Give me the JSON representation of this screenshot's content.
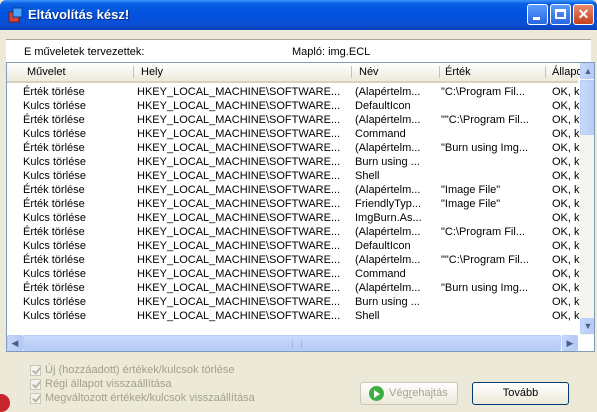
{
  "window": {
    "title": "Eltávolítás kész!"
  },
  "info": {
    "left": "E műveletek tervezettek:",
    "right": "Mapló: img.ECL"
  },
  "columns": [
    "Művelet",
    "Hely",
    "Név",
    "Érték",
    "Állapot"
  ],
  "rows": [
    [
      "Érték törlése",
      "HKEY_LOCAL_MACHINE\\SOFTWARE...",
      "(Alapértelm...",
      "\"C:\\Program Fil...",
      "OK, k..."
    ],
    [
      "Kulcs törlése",
      "HKEY_LOCAL_MACHINE\\SOFTWARE...",
      "DefaultIcon",
      "",
      "OK, k..."
    ],
    [
      "Érték törlése",
      "HKEY_LOCAL_MACHINE\\SOFTWARE...",
      "(Alapértelm...",
      "\"\"C:\\Program Fil...",
      "OK, k..."
    ],
    [
      "Kulcs törlése",
      "HKEY_LOCAL_MACHINE\\SOFTWARE...",
      "Command",
      "",
      "OK, k..."
    ],
    [
      "Érték törlése",
      "HKEY_LOCAL_MACHINE\\SOFTWARE...",
      "(Alapértelm...",
      "\"Burn using Img...",
      "OK, k..."
    ],
    [
      "Kulcs törlése",
      "HKEY_LOCAL_MACHINE\\SOFTWARE...",
      "Burn using ...",
      "",
      "OK, k..."
    ],
    [
      "Kulcs törlése",
      "HKEY_LOCAL_MACHINE\\SOFTWARE...",
      "Shell",
      "",
      "OK, k..."
    ],
    [
      "Érték törlése",
      "HKEY_LOCAL_MACHINE\\SOFTWARE...",
      "(Alapértelm...",
      "\"Image File\"",
      "OK, k..."
    ],
    [
      "Érték törlése",
      "HKEY_LOCAL_MACHINE\\SOFTWARE...",
      "FriendlyTyp...",
      "\"Image File\"",
      "OK, k..."
    ],
    [
      "Kulcs törlése",
      "HKEY_LOCAL_MACHINE\\SOFTWARE...",
      "ImgBurn.As...",
      "",
      "OK, k..."
    ],
    [
      "Érték törlése",
      "HKEY_LOCAL_MACHINE\\SOFTWARE...",
      "(Alapértelm...",
      "\"C:\\Program Fil...",
      "OK, k..."
    ],
    [
      "Kulcs törlése",
      "HKEY_LOCAL_MACHINE\\SOFTWARE...",
      "DefaultIcon",
      "",
      "OK, k..."
    ],
    [
      "Érték törlése",
      "HKEY_LOCAL_MACHINE\\SOFTWARE...",
      "(Alapértelm...",
      "\"\"C:\\Program Fil...",
      "OK, k..."
    ],
    [
      "Kulcs törlése",
      "HKEY_LOCAL_MACHINE\\SOFTWARE...",
      "Command",
      "",
      "OK, k..."
    ],
    [
      "Érték törlése",
      "HKEY_LOCAL_MACHINE\\SOFTWARE...",
      "(Alapértelm...",
      "\"Burn using Img...",
      "OK, k..."
    ],
    [
      "Kulcs törlése",
      "HKEY_LOCAL_MACHINE\\SOFTWARE...",
      "Burn using ...",
      "",
      "OK, k..."
    ],
    [
      "Kulcs törlése",
      "HKEY_LOCAL_MACHINE\\SOFTWARE...",
      "Shell",
      "",
      "OK, k..."
    ]
  ],
  "options": [
    "Új (hozzáadott) értékek/kulcsok törlése",
    "Régi állapot visszaállítása",
    "Megváltozott értékek/kulcsok visszaállítása"
  ],
  "buttons": {
    "exec_prefix": "Vég",
    "exec_underline": "r",
    "exec_suffix": "ehajtás",
    "next": "Tovább"
  },
  "icons": {
    "title": "uninstall-icon",
    "execute": "play-icon"
  },
  "colors": {
    "titlebar": "#0053e1",
    "close": "#c6401c",
    "play": "#3cae44"
  }
}
